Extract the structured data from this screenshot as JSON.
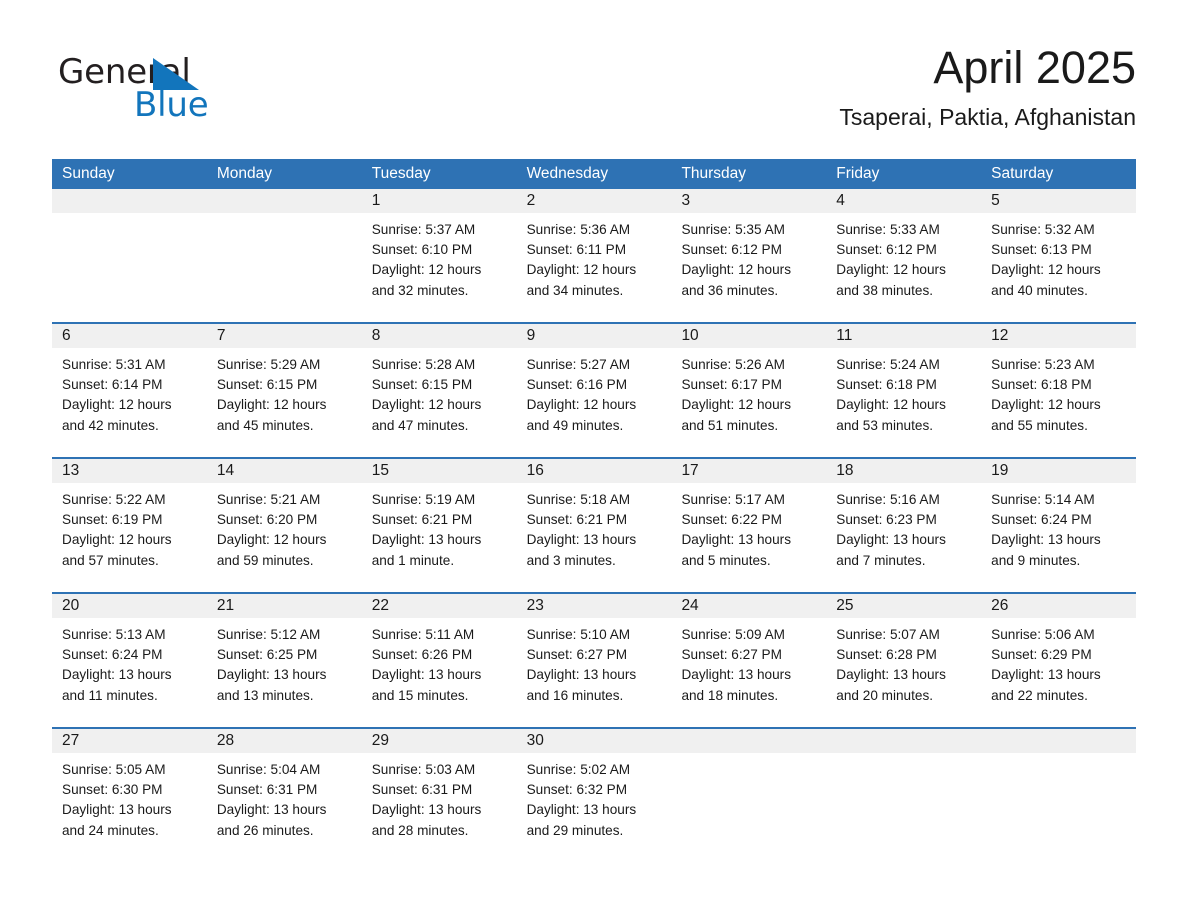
{
  "brand": {
    "name_part1": "General",
    "name_part2": "Blue",
    "triangle_color": "#1275bc",
    "text_color": "#231f20"
  },
  "header": {
    "title": "April 2025",
    "subtitle": "Tsaperai, Paktia, Afghanistan"
  },
  "theme": {
    "header_blue": "#2e72b4",
    "day_band_gray": "#f0f0f0",
    "text": "#1a1a1a",
    "page_background": "#ffffff"
  },
  "calendar": {
    "weekday_headers": [
      "Sunday",
      "Monday",
      "Tuesday",
      "Wednesday",
      "Thursday",
      "Friday",
      "Saturday"
    ],
    "weeks": [
      [
        {
          "day": "",
          "lines": []
        },
        {
          "day": "",
          "lines": []
        },
        {
          "day": "1",
          "lines": [
            "Sunrise: 5:37 AM",
            "Sunset: 6:10 PM",
            "Daylight: 12 hours",
            "and 32 minutes."
          ]
        },
        {
          "day": "2",
          "lines": [
            "Sunrise: 5:36 AM",
            "Sunset: 6:11 PM",
            "Daylight: 12 hours",
            "and 34 minutes."
          ]
        },
        {
          "day": "3",
          "lines": [
            "Sunrise: 5:35 AM",
            "Sunset: 6:12 PM",
            "Daylight: 12 hours",
            "and 36 minutes."
          ]
        },
        {
          "day": "4",
          "lines": [
            "Sunrise: 5:33 AM",
            "Sunset: 6:12 PM",
            "Daylight: 12 hours",
            "and 38 minutes."
          ]
        },
        {
          "day": "5",
          "lines": [
            "Sunrise: 5:32 AM",
            "Sunset: 6:13 PM",
            "Daylight: 12 hours",
            "and 40 minutes."
          ]
        }
      ],
      [
        {
          "day": "6",
          "lines": [
            "Sunrise: 5:31 AM",
            "Sunset: 6:14 PM",
            "Daylight: 12 hours",
            "and 42 minutes."
          ]
        },
        {
          "day": "7",
          "lines": [
            "Sunrise: 5:29 AM",
            "Sunset: 6:15 PM",
            "Daylight: 12 hours",
            "and 45 minutes."
          ]
        },
        {
          "day": "8",
          "lines": [
            "Sunrise: 5:28 AM",
            "Sunset: 6:15 PM",
            "Daylight: 12 hours",
            "and 47 minutes."
          ]
        },
        {
          "day": "9",
          "lines": [
            "Sunrise: 5:27 AM",
            "Sunset: 6:16 PM",
            "Daylight: 12 hours",
            "and 49 minutes."
          ]
        },
        {
          "day": "10",
          "lines": [
            "Sunrise: 5:26 AM",
            "Sunset: 6:17 PM",
            "Daylight: 12 hours",
            "and 51 minutes."
          ]
        },
        {
          "day": "11",
          "lines": [
            "Sunrise: 5:24 AM",
            "Sunset: 6:18 PM",
            "Daylight: 12 hours",
            "and 53 minutes."
          ]
        },
        {
          "day": "12",
          "lines": [
            "Sunrise: 5:23 AM",
            "Sunset: 6:18 PM",
            "Daylight: 12 hours",
            "and 55 minutes."
          ]
        }
      ],
      [
        {
          "day": "13",
          "lines": [
            "Sunrise: 5:22 AM",
            "Sunset: 6:19 PM",
            "Daylight: 12 hours",
            "and 57 minutes."
          ]
        },
        {
          "day": "14",
          "lines": [
            "Sunrise: 5:21 AM",
            "Sunset: 6:20 PM",
            "Daylight: 12 hours",
            "and 59 minutes."
          ]
        },
        {
          "day": "15",
          "lines": [
            "Sunrise: 5:19 AM",
            "Sunset: 6:21 PM",
            "Daylight: 13 hours",
            "and 1 minute."
          ]
        },
        {
          "day": "16",
          "lines": [
            "Sunrise: 5:18 AM",
            "Sunset: 6:21 PM",
            "Daylight: 13 hours",
            "and 3 minutes."
          ]
        },
        {
          "day": "17",
          "lines": [
            "Sunrise: 5:17 AM",
            "Sunset: 6:22 PM",
            "Daylight: 13 hours",
            "and 5 minutes."
          ]
        },
        {
          "day": "18",
          "lines": [
            "Sunrise: 5:16 AM",
            "Sunset: 6:23 PM",
            "Daylight: 13 hours",
            "and 7 minutes."
          ]
        },
        {
          "day": "19",
          "lines": [
            "Sunrise: 5:14 AM",
            "Sunset: 6:24 PM",
            "Daylight: 13 hours",
            "and 9 minutes."
          ]
        }
      ],
      [
        {
          "day": "20",
          "lines": [
            "Sunrise: 5:13 AM",
            "Sunset: 6:24 PM",
            "Daylight: 13 hours",
            "and 11 minutes."
          ]
        },
        {
          "day": "21",
          "lines": [
            "Sunrise: 5:12 AM",
            "Sunset: 6:25 PM",
            "Daylight: 13 hours",
            "and 13 minutes."
          ]
        },
        {
          "day": "22",
          "lines": [
            "Sunrise: 5:11 AM",
            "Sunset: 6:26 PM",
            "Daylight: 13 hours",
            "and 15 minutes."
          ]
        },
        {
          "day": "23",
          "lines": [
            "Sunrise: 5:10 AM",
            "Sunset: 6:27 PM",
            "Daylight: 13 hours",
            "and 16 minutes."
          ]
        },
        {
          "day": "24",
          "lines": [
            "Sunrise: 5:09 AM",
            "Sunset: 6:27 PM",
            "Daylight: 13 hours",
            "and 18 minutes."
          ]
        },
        {
          "day": "25",
          "lines": [
            "Sunrise: 5:07 AM",
            "Sunset: 6:28 PM",
            "Daylight: 13 hours",
            "and 20 minutes."
          ]
        },
        {
          "day": "26",
          "lines": [
            "Sunrise: 5:06 AM",
            "Sunset: 6:29 PM",
            "Daylight: 13 hours",
            "and 22 minutes."
          ]
        }
      ],
      [
        {
          "day": "27",
          "lines": [
            "Sunrise: 5:05 AM",
            "Sunset: 6:30 PM",
            "Daylight: 13 hours",
            "and 24 minutes."
          ]
        },
        {
          "day": "28",
          "lines": [
            "Sunrise: 5:04 AM",
            "Sunset: 6:31 PM",
            "Daylight: 13 hours",
            "and 26 minutes."
          ]
        },
        {
          "day": "29",
          "lines": [
            "Sunrise: 5:03 AM",
            "Sunset: 6:31 PM",
            "Daylight: 13 hours",
            "and 28 minutes."
          ]
        },
        {
          "day": "30",
          "lines": [
            "Sunrise: 5:02 AM",
            "Sunset: 6:32 PM",
            "Daylight: 13 hours",
            "and 29 minutes."
          ]
        },
        {
          "day": "",
          "lines": []
        },
        {
          "day": "",
          "lines": []
        },
        {
          "day": "",
          "lines": []
        }
      ]
    ]
  }
}
